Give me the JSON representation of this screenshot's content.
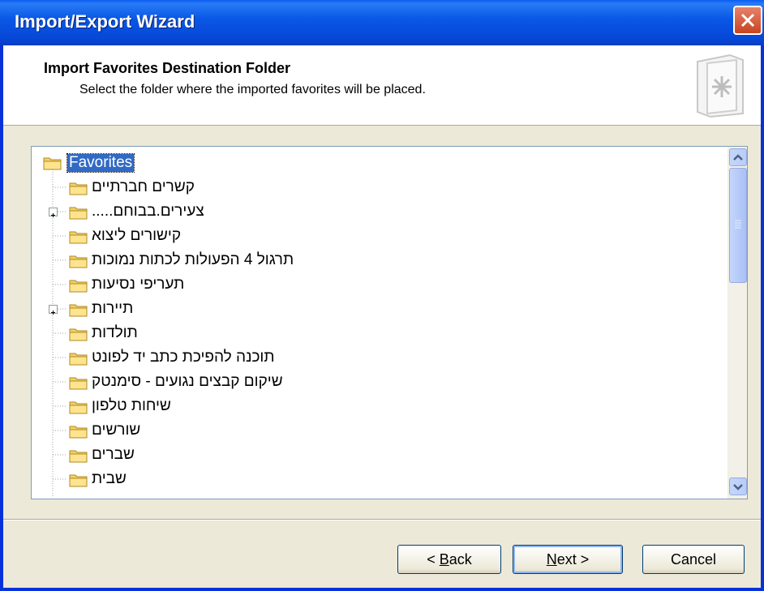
{
  "window": {
    "title": "Import/Export Wizard"
  },
  "header": {
    "title": "Import Favorites Destination Folder",
    "subtitle": "Select the folder where the imported favorites will be placed."
  },
  "tree": {
    "root": "Favorites",
    "items": [
      {
        "label": "קשרים חברתיים",
        "expandable": false
      },
      {
        "label": "צעירים.בבוחם.....",
        "expandable": true
      },
      {
        "label": "קישורים ליצוא",
        "expandable": false
      },
      {
        "label": "תרגול 4 הפעולות לכתות נמוכות",
        "expandable": false
      },
      {
        "label": "תעריפי נסיעות",
        "expandable": false
      },
      {
        "label": "תיירות",
        "expandable": true
      },
      {
        "label": "תולדות",
        "expandable": false
      },
      {
        "label": "תוכנה להפיכת כתב יד לפונט",
        "expandable": false
      },
      {
        "label": "שיקום קבצים נגועים - סימנטק",
        "expandable": false
      },
      {
        "label": "שיחות טלפון",
        "expandable": false
      },
      {
        "label": "שורשים",
        "expandable": false
      },
      {
        "label": "שברים",
        "expandable": false
      },
      {
        "label": "שבית",
        "expandable": false
      }
    ]
  },
  "buttons": {
    "back": {
      "prefix": "< ",
      "mnemonic": "B",
      "rest": "ack"
    },
    "next": {
      "mnemonic": "N",
      "rest": "ext >"
    },
    "cancel": "Cancel"
  },
  "colors": {
    "titlebar": "#0a58e6",
    "selection": "#316ac5",
    "close": "#c9441f"
  },
  "icons": [
    "close-icon",
    "wizard-icon",
    "folder-icon",
    "plus-icon",
    "scroll-up-icon",
    "scroll-down-icon"
  ]
}
